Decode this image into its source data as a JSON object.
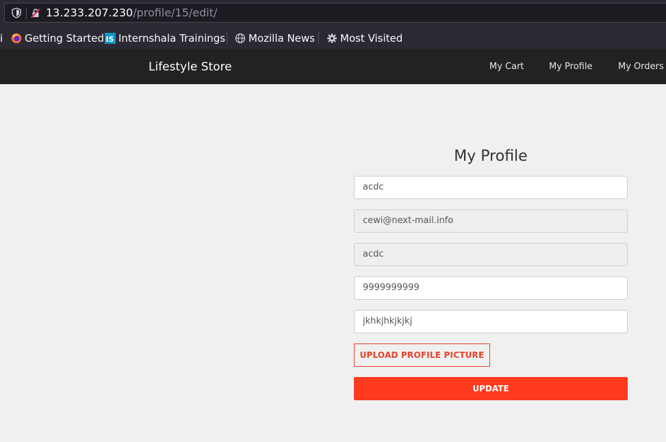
{
  "browser": {
    "url_host": "13.233.207.230",
    "url_path": "/profile/15/edit/"
  },
  "bookmarks": [
    {
      "label": "Getting Started",
      "icon": "firefox-icon"
    },
    {
      "label": "Internshala Trainings",
      "icon": "internshala-icon"
    },
    {
      "label": "Mozilla News",
      "icon": "globe-icon"
    },
    {
      "label": "Most Visited",
      "icon": "gear-icon"
    }
  ],
  "bookmarks_edge": "i",
  "navbar": {
    "brand": "Lifestyle Store",
    "links": [
      "My Cart",
      "My Profile",
      "My Orders"
    ]
  },
  "profile": {
    "title": "My Profile",
    "fields": {
      "name": "acdc",
      "email": "cewi@next-mail.info",
      "username": "acdc",
      "phone": "9999999999",
      "address": "jkhkjhkjkjkj"
    },
    "upload_label": "UPLOAD PROFILE PICTURE",
    "update_label": "UPDATE"
  },
  "colors": {
    "accent": "#ff3a1d",
    "navbar_bg": "#222222",
    "page_bg": "#f0f0f0"
  }
}
